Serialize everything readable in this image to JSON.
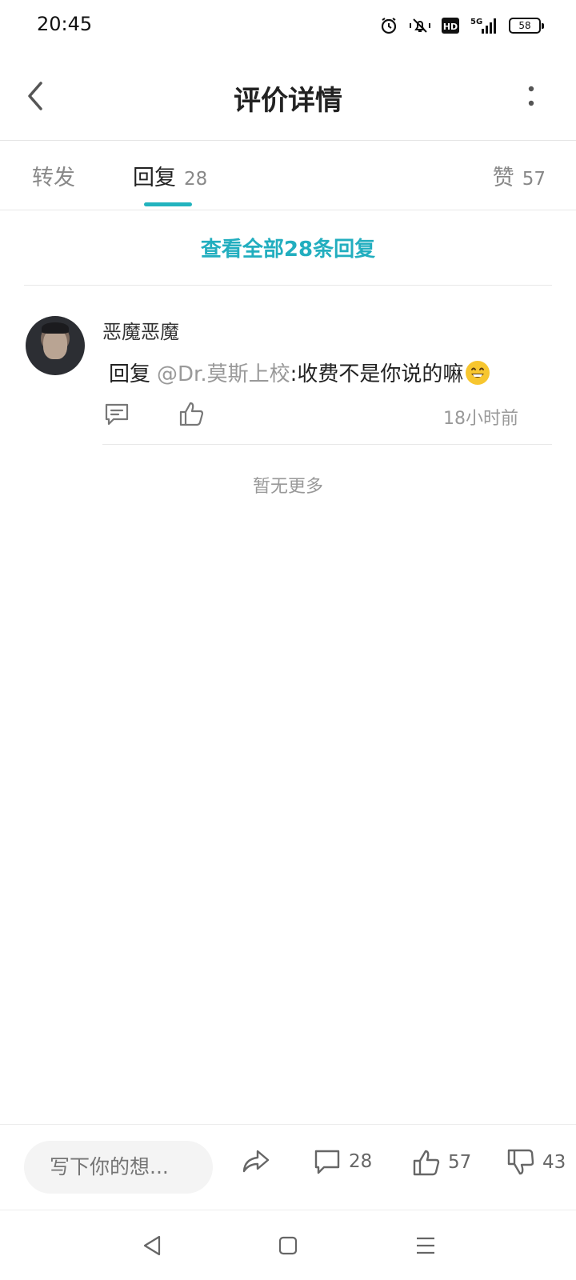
{
  "status_bar": {
    "time": "20:45",
    "network": "5G",
    "hd_badge": "HD",
    "battery": "58",
    "icons": [
      "alarm-icon",
      "mute-vibrate-icon",
      "hd-icon",
      "signal-5g-icon",
      "battery-icon"
    ]
  },
  "header": {
    "title": "评价详情",
    "back_icon": "chevron-left-icon",
    "more_icon": "more-vertical-icon"
  },
  "tabs": {
    "forward": {
      "label": "转发"
    },
    "reply": {
      "label": "回复",
      "count": "28"
    },
    "like": {
      "label": "赞",
      "count": "57"
    },
    "active": "reply",
    "accent_color": "#22b3be"
  },
  "view_all": {
    "label": "查看全部28条回复"
  },
  "comment": {
    "username": "恶魔恶魔",
    "reply_prefix": "回复",
    "mention": "@Dr.莫斯上校",
    "text": ":收费不是你说的嘛",
    "emoji": "grinning-face",
    "time": "18小时前"
  },
  "no_more": "暂无更多",
  "bottom_bar": {
    "input_placeholder": "写下你的想...",
    "comment_count": "28",
    "like_count": "57",
    "dislike_count": "43"
  }
}
